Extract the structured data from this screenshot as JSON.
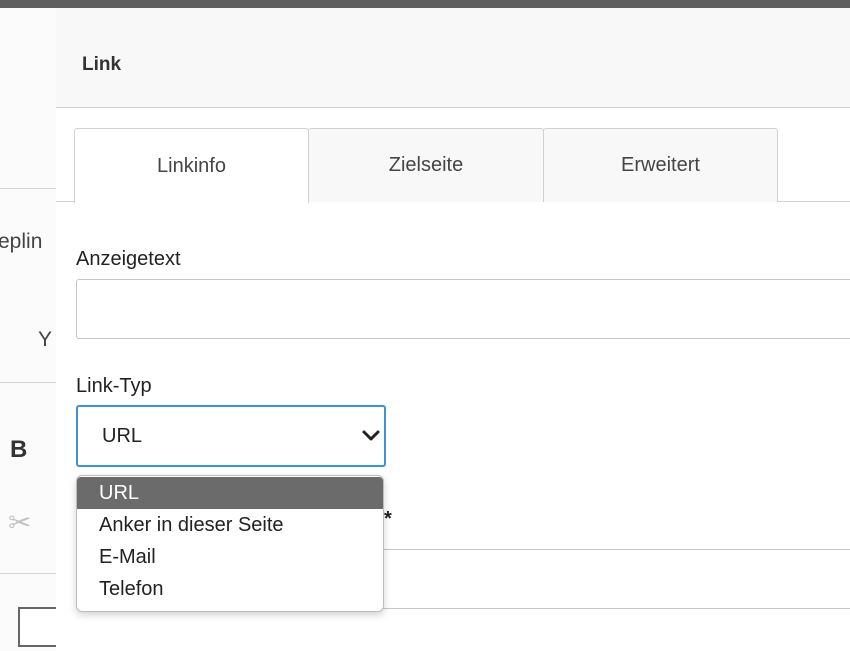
{
  "background": {
    "partial_text_1": "eplin",
    "partial_text_2": "Y",
    "bold_button": "B",
    "scissors_glyph": "✂"
  },
  "dialog": {
    "title": "Link",
    "tabs": [
      {
        "label": "Linkinfo",
        "active": true
      },
      {
        "label": "Zielseite",
        "active": false
      },
      {
        "label": "Erweitert",
        "active": false
      }
    ],
    "display_text_label": "Anzeigetext",
    "display_text_value": "",
    "link_type_label": "Link-Typ",
    "link_type_value": "URL",
    "link_type_options": [
      {
        "label": "URL",
        "selected": true
      },
      {
        "label": "Anker in dieser Seite",
        "selected": false
      },
      {
        "label": "E-Mail",
        "selected": false
      },
      {
        "label": "Telefon",
        "selected": false
      }
    ],
    "hidden_field_label_fragment": "*",
    "hidden_field_value": ""
  },
  "colors": {
    "focus_border": "#3f93d2",
    "selected_option_bg": "#6b6b6b"
  },
  "icons": {
    "select_chevron": "chevron-down-icon",
    "background_cut": "scissors-icon"
  }
}
